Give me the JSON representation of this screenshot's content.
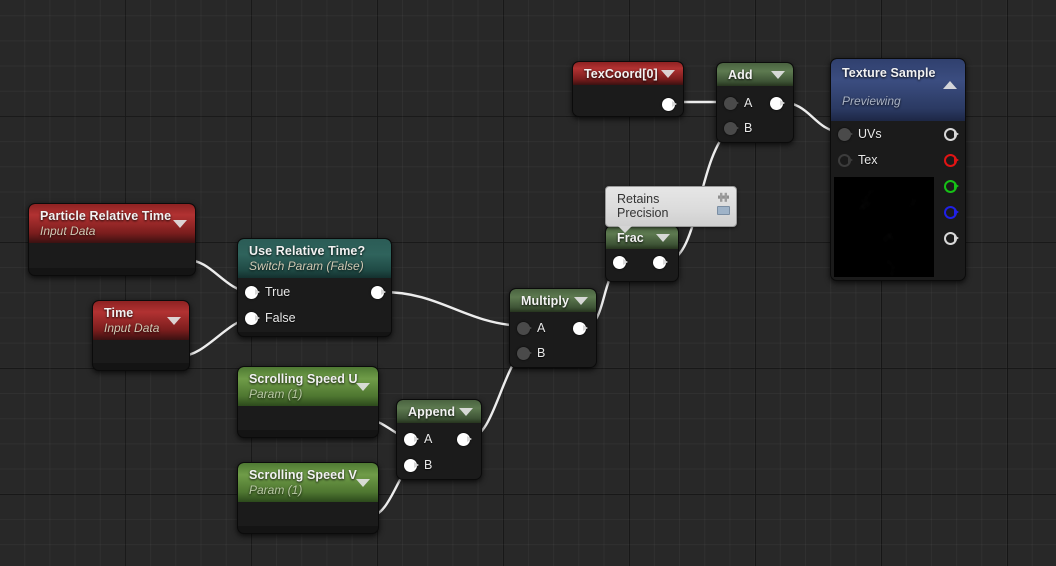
{
  "app": {
    "editor": "Unreal Material Editor Node Graph",
    "canvas_bg": "#282828",
    "grid_minor": "rgba(255,255,255,0.035)",
    "grid_major": "rgba(0,0,0,0.55)"
  },
  "comment": {
    "text": "Retains Precision",
    "pin_icon": "pin-icon",
    "keyboard_icon": "keyboard-icon"
  },
  "nodes": {
    "particle_relative_time": {
      "title": "Particle Relative Time",
      "subtitle": "Input Data",
      "header_color": "#b23232",
      "caret": "chevron-down-icon",
      "outputs": [
        {
          "label": "",
          "state": "filled"
        }
      ]
    },
    "time": {
      "title": "Time",
      "subtitle": "Input Data",
      "header_color": "#b23232",
      "caret": "chevron-down-icon",
      "outputs": [
        {
          "label": "",
          "state": "filled"
        }
      ]
    },
    "use_relative_time": {
      "title": "Use Relative Time?",
      "subtitle": "Switch Param (False)",
      "header_color": "#2f635c",
      "caret": "chevron-down-icon",
      "inputs": [
        {
          "label": "True",
          "state": "filled"
        },
        {
          "label": "False",
          "state": "filled"
        }
      ],
      "outputs": [
        {
          "label": "",
          "state": "filled"
        }
      ]
    },
    "scrolling_speed_u": {
      "title": "Scrolling Speed U",
      "subtitle": "Param (1)",
      "header_color": "#6f9c48",
      "caret": "chevron-down-icon",
      "outputs": [
        {
          "label": "",
          "state": "filled"
        }
      ]
    },
    "scrolling_speed_v": {
      "title": "Scrolling Speed V",
      "subtitle": "Param (1)",
      "header_color": "#6f9c48",
      "caret": "chevron-down-icon",
      "outputs": [
        {
          "label": "",
          "state": "filled"
        }
      ]
    },
    "append": {
      "title": "Append",
      "subtitle": "",
      "header_color": "#5d7a50",
      "caret": "chevron-down-icon",
      "inputs": [
        {
          "label": "A",
          "state": "filled"
        },
        {
          "label": "B",
          "state": "filled"
        }
      ],
      "outputs": [
        {
          "label": "",
          "state": "filled"
        }
      ]
    },
    "multiply": {
      "title": "Multiply",
      "subtitle": "",
      "header_color": "#5d7a50",
      "caret": "chevron-down-icon",
      "inputs": [
        {
          "label": "A",
          "state": "dim"
        },
        {
          "label": "B",
          "state": "dim"
        }
      ],
      "outputs": [
        {
          "label": "",
          "state": "filled"
        }
      ]
    },
    "frac": {
      "title": "Frac",
      "subtitle": "",
      "header_color": "#5d7a50",
      "caret": "chevron-down-icon",
      "inputs": [
        {
          "label": "",
          "state": "filled"
        }
      ],
      "outputs": [
        {
          "label": "",
          "state": "filled"
        }
      ]
    },
    "texcoord": {
      "title": "TexCoord[0]",
      "subtitle": "",
      "header_color": "#b23232",
      "caret": "chevron-down-icon",
      "outputs": [
        {
          "label": "",
          "state": "filled"
        }
      ]
    },
    "add": {
      "title": "Add",
      "subtitle": "",
      "header_color": "#5d7a50",
      "caret": "chevron-down-icon",
      "inputs": [
        {
          "label": "A",
          "state": "dim"
        },
        {
          "label": "B",
          "state": "dim"
        }
      ],
      "outputs": [
        {
          "label": "",
          "state": "filled"
        }
      ]
    },
    "texture_sample": {
      "title": "Texture Sample",
      "subtitle": "Previewing",
      "header_color": "#3b4d80",
      "caret": "chevron-up-icon",
      "inputs": [
        {
          "label": "UVs",
          "state": "dim"
        },
        {
          "label": "Tex",
          "state": "ring"
        }
      ],
      "outputs": [
        {
          "label": "",
          "state": "ring",
          "color": "#d8d8d8"
        },
        {
          "label": "",
          "state": "ring-r",
          "color": "#e01414"
        },
        {
          "label": "",
          "state": "ring-g",
          "color": "#16c016"
        },
        {
          "label": "",
          "state": "ring-b",
          "color": "#2020e6"
        },
        {
          "label": "",
          "state": "ring",
          "color": "#d8d8d8"
        }
      ],
      "preview_thumbnail": "grayscale-noise-texture"
    }
  },
  "connections": [
    {
      "from": "particle_relative_time.out",
      "to": "use_relative_time.True"
    },
    {
      "from": "time.out",
      "to": "use_relative_time.False"
    },
    {
      "from": "use_relative_time.out",
      "to": "multiply.A"
    },
    {
      "from": "scrolling_speed_u.out",
      "to": "append.A"
    },
    {
      "from": "scrolling_speed_v.out",
      "to": "append.B"
    },
    {
      "from": "append.out",
      "to": "multiply.B"
    },
    {
      "from": "multiply.out",
      "to": "frac.in"
    },
    {
      "from": "frac.out",
      "to": "add.B"
    },
    {
      "from": "texcoord.out",
      "to": "add.A"
    },
    {
      "from": "add.out",
      "to": "texture_sample.UVs"
    }
  ]
}
